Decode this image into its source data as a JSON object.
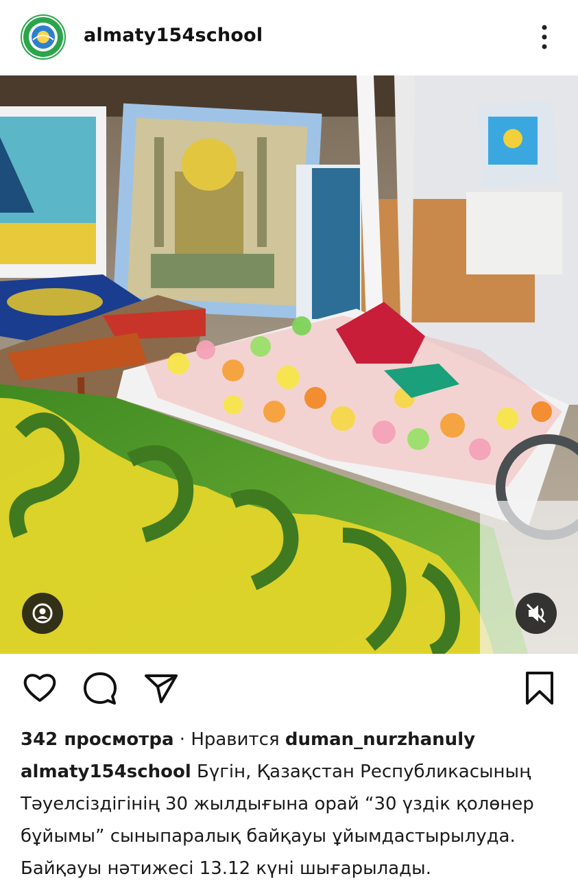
{
  "header": {
    "username": "almaty154school",
    "avatar_icon": "school-emblem-icon",
    "avatar_text_top": "ALATAU AUDANY",
    "avatar_text_bottom": "ALMATY",
    "more_icon": "more-vertical-icon"
  },
  "media": {
    "description_icon": "video-post",
    "tag_icon": "user-tag-icon",
    "mute_icon": "speaker-muted-icon"
  },
  "actions": {
    "like_icon": "heart-icon",
    "comment_icon": "comment-icon",
    "share_icon": "send-icon",
    "save_icon": "bookmark-icon"
  },
  "stats": {
    "views": "342 просмотра",
    "separator": " · ",
    "liked_prefix": "Нравится ",
    "liked_by": "duman_nurzhanuly"
  },
  "caption": {
    "author": "almaty154school",
    "text": " Бүгін, Қазақстан Республикасының Тәуелсіздігінің 30 жылдығына орай “30 үздік қолөнер бұйымы” сыныпаралық байқауы ұйымдастырылуда. Байқауы нәтижесі 13.12 күні шығарылады."
  },
  "colors": {
    "accent_green": "#27a74a",
    "table_yellow": "#e7d62a",
    "table_green": "#4c9a2a"
  }
}
